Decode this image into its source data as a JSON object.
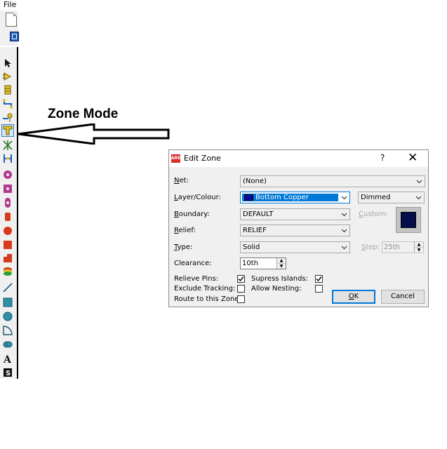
{
  "menu": {
    "file": "File"
  },
  "annotation": {
    "label": "Zone Mode"
  },
  "dialog": {
    "app_icon_text": "ARES",
    "title": "Edit Zone",
    "help": "?",
    "close": "✕",
    "net": {
      "label_u": "N",
      "label_rest": "et:",
      "value": "(None)"
    },
    "layer": {
      "label_u": "L",
      "label_rest": "ayer/Colour:",
      "value": "Bottom Copper",
      "color": "#0a0aa0",
      "selection_color": "#0078d7"
    },
    "dimmed": {
      "value": "Dimmed"
    },
    "boundary": {
      "label_u": "B",
      "label_rest": "oundary:",
      "value": "DEFAULT"
    },
    "custom": {
      "label_u": "C",
      "label_rest": "ustom:",
      "color": "#050d4a"
    },
    "relief": {
      "label_u": "R",
      "label_rest": "elief:",
      "value": "RELIEF"
    },
    "type": {
      "label_u": "T",
      "label_rest": "ype:",
      "value": "Solid"
    },
    "step": {
      "label_u": "S",
      "label_rest": "tep:",
      "value": "25th"
    },
    "clearance": {
      "label": "Clearance:",
      "value": "10th"
    },
    "relieve_pins": {
      "label": "Relieve Pins:",
      "checked": true
    },
    "supress_islands": {
      "label": "Supress Islands:",
      "checked": true
    },
    "exclude_tracking": {
      "label": "Exclude Tracking:",
      "checked": false
    },
    "allow_nesting": {
      "label": "Allow Nesting:",
      "checked": false
    },
    "route_to_zone": {
      "label": "Route to this Zone:",
      "checked": false
    },
    "ok": {
      "label_u": "O",
      "label_rest": "K"
    },
    "cancel": {
      "label": "Cancel"
    }
  },
  "toolbar_tools": [
    "select-mode-icon",
    "component-mode-icon",
    "package-mode-icon",
    "track-mode-icon",
    "via-mode-icon",
    "zone-mode-icon",
    "ratsnest-mode-icon",
    "connectivity-highlight-icon",
    "round-pad-icon",
    "square-pad-icon",
    "dil-pad-icon",
    "edge-connector-pad-icon",
    "circular-smt-pad-icon",
    "rectangular-smt-pad-icon",
    "polygonal-pad-icon",
    "padstack-icon",
    "line-graphics-icon",
    "box-graphics-icon",
    "circle-graphics-icon",
    "arc-graphics-icon",
    "closed-path-icon",
    "text-icon",
    "symbol-icon"
  ]
}
